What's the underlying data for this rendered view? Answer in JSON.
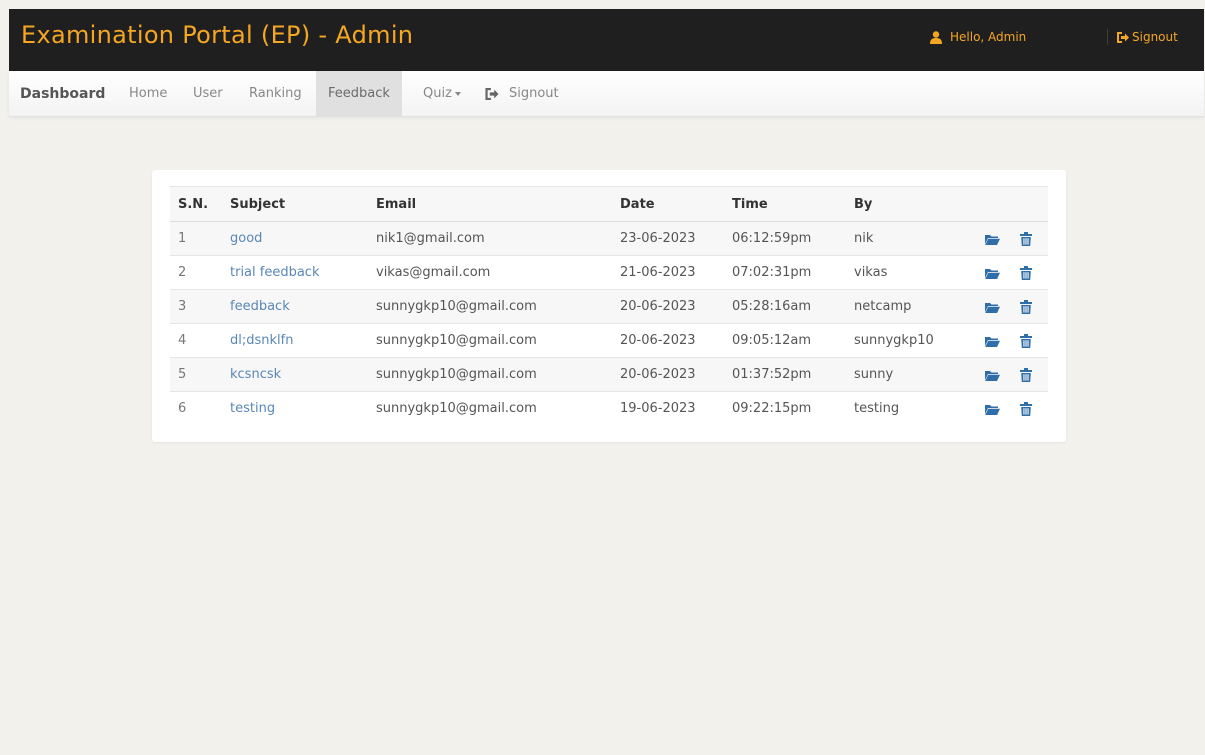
{
  "header": {
    "title": "Examination Portal (EP) - Admin",
    "greeting": "Hello,  Admin",
    "signout_label": "Signout"
  },
  "nav": {
    "brand": "Dashboard",
    "items": [
      "Home",
      "User",
      "Ranking",
      "Feedback",
      "Quiz",
      "Signout"
    ],
    "active": "Feedback"
  },
  "table": {
    "columns": [
      "S.N.",
      "Subject",
      "Email",
      "Date",
      "Time",
      "By"
    ],
    "rows": [
      {
        "sn": "1",
        "subject": "good",
        "email": "nik1@gmail.com",
        "date": "23-06-2023",
        "time": "06:12:59pm",
        "by": "nik"
      },
      {
        "sn": "2",
        "subject": "trial feedback",
        "email": "vikas@gmail.com",
        "date": "21-06-2023",
        "time": "07:02:31pm",
        "by": "vikas"
      },
      {
        "sn": "3",
        "subject": "feedback",
        "email": "sunnygkp10@gmail.com",
        "date": "20-06-2023",
        "time": "05:28:16am",
        "by": "netcamp"
      },
      {
        "sn": "4",
        "subject": "dl;dsnklfn",
        "email": "sunnygkp10@gmail.com",
        "date": "20-06-2023",
        "time": "09:05:12am",
        "by": "sunnygkp10"
      },
      {
        "sn": "5",
        "subject": "kcsncsk",
        "email": "sunnygkp10@gmail.com",
        "date": "20-06-2023",
        "time": "01:37:52pm",
        "by": "sunny"
      },
      {
        "sn": "6",
        "subject": "testing",
        "email": "sunnygkp10@gmail.com",
        "date": "19-06-2023",
        "time": "09:22:15pm",
        "by": "testing"
      }
    ]
  },
  "icons": {
    "user": "user-icon",
    "signout": "signout-icon",
    "open": "folder-open-icon",
    "delete": "trash-icon"
  },
  "colors": {
    "accent": "#f5a623",
    "header_bg": "#1f1f1f",
    "link": "#5a87b8",
    "icon_blue": "#2f6ea8"
  }
}
